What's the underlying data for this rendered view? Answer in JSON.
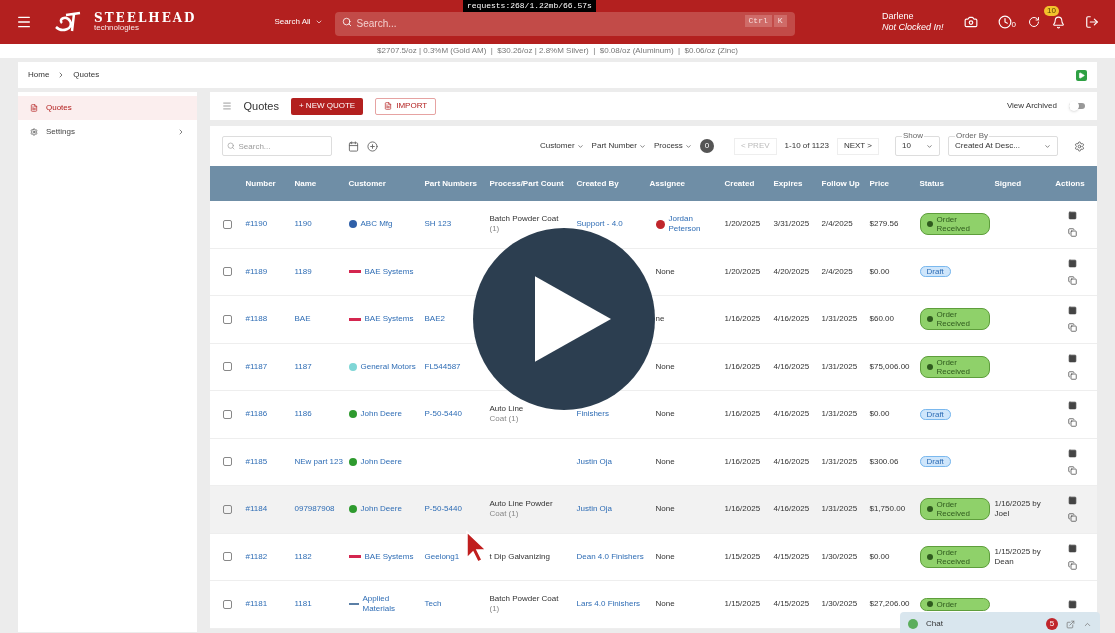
{
  "debug_bar": "requests:268/1.22mb/66.57s",
  "header": {
    "brand": "STEELHEAD",
    "brand_sub": "technologies",
    "search_scope": "Search All",
    "search_placeholder": "Search...",
    "shortcut": [
      "Ctrl",
      "K"
    ],
    "user": "Darlene",
    "clock_status": "Not Clocked In!",
    "clock_count": "0",
    "notifications": "10"
  },
  "ticker": "$2707.5/oz | 0.3%M (Gold AM)  |  $30.26/oz | 2.8%M Silver)  |  $0.08/oz (Aluminum)  |  $0.06/oz (Zinc)",
  "breadcrumb": [
    "Home",
    "Quotes"
  ],
  "sidebar": [
    {
      "label": "Quotes",
      "selected": true,
      "expandable": false
    },
    {
      "label": "Settings",
      "selected": false,
      "expandable": true
    }
  ],
  "page": {
    "title": "Quotes",
    "new_button": "+ NEW QUOTE",
    "import_button": "IMPORT",
    "view_archived": {
      "label": "View Archived",
      "on": false
    }
  },
  "toolbar": {
    "search_placeholder": "Search...",
    "filters": [
      "Customer",
      "Part Number",
      "Process"
    ],
    "filter_count": "0",
    "prev": "< PREV",
    "prev_disabled": true,
    "range": "1-10 of 1123",
    "next": "NEXT >",
    "show": {
      "label": "Show",
      "value": "10"
    },
    "order_by": {
      "label": "Order By",
      "value": "Created At Desc..."
    }
  },
  "table": {
    "columns": [
      "Number",
      "Name",
      "Customer",
      "Part Numbers",
      "Process/Part Count",
      "Created By",
      "Assignee",
      "Created",
      "Expires",
      "Follow Up",
      "Price",
      "Status",
      "Signed",
      "Actions"
    ],
    "rows": [
      {
        "checked": false,
        "highlighted": false,
        "number": "#1190",
        "name": "1190",
        "customer": {
          "name": "ABC Mfg",
          "kind": "circle",
          "color": "#2f5fa8"
        },
        "part": "SH 123",
        "process": "Batch Powder Coat",
        "process_count": "(1)",
        "created_by": "Support - 4.0",
        "assignee": {
          "text": "Jordan Peterson",
          "kind": "user"
        },
        "created": "1/20/2025",
        "expires": "3/31/2025",
        "follow_up": "2/4/2025",
        "price": "$279.56",
        "status": {
          "label": "Order Received",
          "kind": "received"
        }
      },
      {
        "checked": false,
        "highlighted": false,
        "number": "#1189",
        "name": "1189",
        "customer": {
          "name": "BAE Systems",
          "kind": "bar",
          "color": "#d4264f"
        },
        "assignee": {
          "text": "None",
          "kind": "none"
        },
        "created": "1/20/2025",
        "expires": "4/20/2025",
        "follow_up": "2/4/2025",
        "price": "$0.00",
        "status": {
          "label": "Draft",
          "kind": "draft"
        }
      },
      {
        "checked": false,
        "highlighted": false,
        "number": "#1188",
        "name": "BAE",
        "customer": {
          "name": "BAE Systems",
          "kind": "bar",
          "color": "#d4264f"
        },
        "part": "BAE2",
        "assignee": {
          "text": "ne",
          "kind": "none"
        },
        "created": "1/16/2025",
        "expires": "4/16/2025",
        "follow_up": "1/31/2025",
        "price": "$60.00",
        "status": {
          "label": "Order Received",
          "kind": "received"
        }
      },
      {
        "checked": false,
        "highlighted": false,
        "number": "#1187",
        "name": "1187",
        "customer": {
          "name": "General Motors",
          "kind": "circle",
          "color": "#7fd6d6"
        },
        "part": "FL544587",
        "assignee": {
          "text": "None",
          "kind": "none"
        },
        "created": "1/16/2025",
        "expires": "4/16/2025",
        "follow_up": "1/31/2025",
        "price": "$75,006.00",
        "status": {
          "label": "Order Received",
          "kind": "received"
        }
      },
      {
        "checked": false,
        "highlighted": false,
        "number": "#1186",
        "name": "1186",
        "customer": {
          "name": "John Deere",
          "kind": "circle",
          "color": "#2e9a2e"
        },
        "part": "P-50-5440",
        "process": "Auto Line",
        "process_count": "Coat (1)",
        "created_by": "Finishers",
        "assignee": {
          "text": "None",
          "kind": "none"
        },
        "created": "1/16/2025",
        "expires": "4/16/2025",
        "follow_up": "1/31/2025",
        "price": "$0.00",
        "status": {
          "label": "Draft",
          "kind": "draft"
        }
      },
      {
        "checked": false,
        "highlighted": false,
        "number": "#1185",
        "name": "NEw part 123",
        "customer": {
          "name": "John Deere",
          "kind": "circle",
          "color": "#2e9a2e"
        },
        "created_by": "Justin Oja",
        "assignee": {
          "text": "None",
          "kind": "none"
        },
        "created": "1/16/2025",
        "expires": "4/16/2025",
        "follow_up": "1/31/2025",
        "price": "$300.06",
        "status": {
          "label": "Draft",
          "kind": "draft"
        }
      },
      {
        "checked": false,
        "highlighted": true,
        "number": "#1184",
        "name": "097987908",
        "customer": {
          "name": "John Deere",
          "kind": "circle",
          "color": "#2e9a2e"
        },
        "part": "P-50-5440",
        "process": "Auto Line Powder",
        "process_count": "Coat (1)",
        "created_by": "Justin Oja",
        "assignee": {
          "text": "None",
          "kind": "none"
        },
        "created": "1/16/2025",
        "expires": "4/16/2025",
        "follow_up": "1/31/2025",
        "price": "$1,750.00",
        "status": {
          "label": "Order Received",
          "kind": "received"
        },
        "signed": "1/16/2025 by Joel"
      },
      {
        "checked": false,
        "highlighted": false,
        "number": "#1182",
        "name": "1182",
        "customer": {
          "name": "BAE Systems",
          "kind": "bar",
          "color": "#d4264f"
        },
        "part": "Geelong1",
        "process": "t Dip Galvanizing",
        "created_by": "Dean 4.0 Finishers",
        "assignee": {
          "text": "None",
          "kind": "none"
        },
        "created": "1/15/2025",
        "expires": "4/15/2025",
        "follow_up": "1/30/2025",
        "price": "$0.00",
        "status": {
          "label": "Order Received",
          "kind": "received"
        },
        "signed": "1/15/2025 by Dean"
      },
      {
        "checked": false,
        "highlighted": false,
        "number": "#1181",
        "name": "1181",
        "customer": {
          "name": "Applied Materials",
          "kind": "line",
          "color": "#5b7fa6"
        },
        "part": "Tech",
        "process": "Batch Powder Coat",
        "process_count": "(1)",
        "created_by": "Lars 4.0 Finishers",
        "assignee": {
          "text": "None",
          "kind": "none"
        },
        "created": "1/15/2025",
        "expires": "4/15/2025",
        "follow_up": "1/30/2025",
        "price": "$27,206.00",
        "status": {
          "label": "Order",
          "kind": "received"
        },
        "copy_visible": false
      }
    ]
  },
  "chat": {
    "label": "Chat",
    "unread": "5"
  }
}
